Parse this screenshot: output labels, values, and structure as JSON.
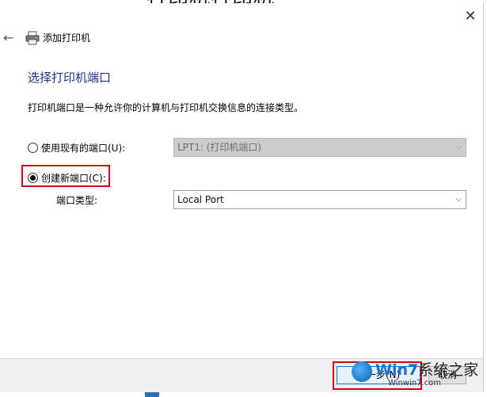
{
  "background": {
    "partial_title": "打印机打印机"
  },
  "window": {
    "close_glyph": "✕"
  },
  "header": {
    "back_glyph": "←",
    "title": "添加打印机",
    "icon": "printer-icon"
  },
  "page": {
    "heading": "选择打印机端口",
    "description": "打印机端口是一种允许你的计算机与打印机交换信息的连接类型。"
  },
  "options": {
    "existing": {
      "label": "使用现有的端口(U):",
      "selected": false,
      "value": "LPT1: (打印机端口)",
      "enabled": false
    },
    "new": {
      "label": "创建新端口(C):",
      "selected": true
    },
    "port_type": {
      "label": "端口类型:",
      "value": "Local Port"
    }
  },
  "footer": {
    "next_label": "下一步(N)",
    "cancel_label": "取消"
  },
  "watermark": {
    "brand": "Win7",
    "cn": "系统之家",
    "url": "Winwin7.com"
  },
  "colors": {
    "heading": "#1e3287",
    "highlight": "#d0021b",
    "primary_border": "#0078d7"
  }
}
